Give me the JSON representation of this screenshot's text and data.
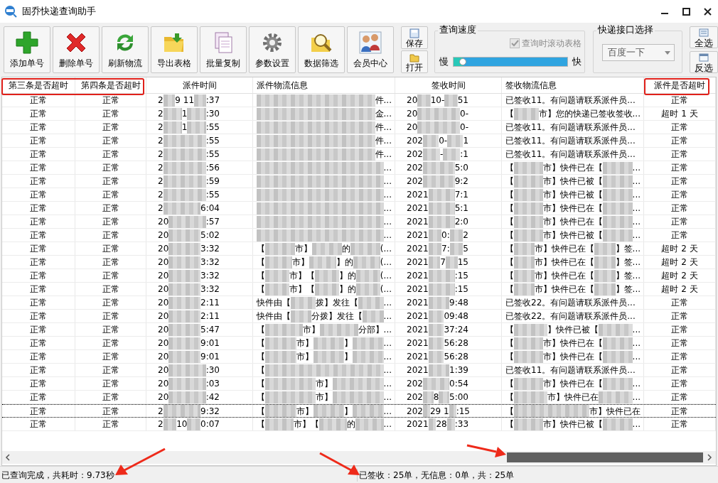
{
  "window": {
    "title": "固乔快递查询助手"
  },
  "toolbar": {
    "buttons": [
      {
        "label": "添加单号",
        "kind": "add"
      },
      {
        "label": "删除单号",
        "kind": "delete"
      },
      {
        "label": "刷新物流",
        "kind": "refresh"
      },
      {
        "label": "导出表格",
        "kind": "export"
      },
      {
        "label": "批量复制",
        "kind": "copy"
      },
      {
        "label": "参数设置",
        "kind": "settings"
      },
      {
        "label": "数据筛选",
        "kind": "filter"
      },
      {
        "label": "会员中心",
        "kind": "members"
      }
    ],
    "small_buttons": [
      {
        "label": "保存",
        "kind": "save"
      },
      {
        "label": "打开",
        "kind": "open"
      }
    ],
    "speed": {
      "title": "查询速度",
      "scroll_checkbox": {
        "label": "查询时滚动表格",
        "checked": true,
        "disabled": true
      },
      "slow": "慢",
      "fast": "快",
      "level": 0.08
    },
    "api": {
      "title": "快递接口选择",
      "dropdown": {
        "value": "百度一下"
      }
    },
    "select_buttons": [
      {
        "label": "全选",
        "kind": "select-all"
      },
      {
        "label": "反选",
        "kind": "invert"
      }
    ]
  },
  "table": {
    "columns": [
      "第三条是否超时",
      "第四条是否超时",
      "派件时间",
      "派件物流信息",
      "签收时间",
      "签收物流信息",
      "派件是否超时"
    ],
    "rows": [
      {
        "third": "正常",
        "fourth": "正常",
        "dispatch_time": [
          "2",
          "9 11",
          ":37"
        ],
        "dispatch_info": [
          "件..."
        ],
        "sign_time": [
          "20",
          "10-",
          "51"
        ],
        "sign_info": "已签收11。有问题请联系派件员...",
        "timeout_text": "正常",
        "focused": false
      },
      {
        "third": "正常",
        "fourth": "正常",
        "dispatch_time": [
          "2",
          "1",
          ":30"
        ],
        "dispatch_info": [
          "金..."
        ],
        "sign_time": [
          "20",
          "0-"
        ],
        "sign_info": [
          "【",
          "市】您的快递已签收签收..."
        ],
        "timeout_text": "超时 1 天",
        "focused": false
      },
      {
        "third": "正常",
        "fourth": "正常",
        "dispatch_time": [
          "2",
          "1",
          ":55"
        ],
        "dispatch_info": [
          "件..."
        ],
        "sign_time": [
          "20",
          "0-"
        ],
        "sign_info": "已签收11。有问题请联系派件员...",
        "timeout_text": "正常",
        "focused": false
      },
      {
        "third": "正常",
        "fourth": "正常",
        "dispatch_time": [
          "2",
          ":55"
        ],
        "dispatch_info": [
          "件..."
        ],
        "sign_time": [
          "202",
          "0-",
          "1"
        ],
        "sign_info": "已签收11。有问题请联系派件员...",
        "timeout_text": "正常",
        "focused": false
      },
      {
        "third": "正常",
        "fourth": "正常",
        "dispatch_time": [
          "2",
          ":55"
        ],
        "dispatch_info": [
          "件..."
        ],
        "sign_time": [
          "202",
          "-",
          ":1"
        ],
        "sign_info": "已签收11。有问题请联系派件员...",
        "timeout_text": "正常",
        "focused": false
      },
      {
        "third": "正常",
        "fourth": "正常",
        "dispatch_time": [
          "2",
          ":56"
        ],
        "dispatch_info": [
          "..."
        ],
        "sign_time": [
          "202",
          "5:0"
        ],
        "sign_info": [
          "【",
          "市】快件已在【",
          "..."
        ],
        "timeout_text": "正常",
        "focused": false
      },
      {
        "third": "正常",
        "fourth": "正常",
        "dispatch_time": [
          "2",
          ":59"
        ],
        "dispatch_info": [
          "..."
        ],
        "sign_time": [
          "202",
          "9:2"
        ],
        "sign_info": [
          "【",
          "市】快件已被【",
          "..."
        ],
        "timeout_text": "正常",
        "focused": false
      },
      {
        "third": "正常",
        "fourth": "正常",
        "dispatch_time": [
          "2",
          ":55"
        ],
        "dispatch_info": [
          "..."
        ],
        "sign_time": [
          "2021",
          "7:1"
        ],
        "sign_info": [
          "【",
          "市】快件已被【",
          "..."
        ],
        "timeout_text": "正常",
        "focused": false
      },
      {
        "third": "正常",
        "fourth": "正常",
        "dispatch_time": [
          "2",
          "6:04"
        ],
        "dispatch_info": [
          "..."
        ],
        "sign_time": [
          "2021",
          "5:1"
        ],
        "sign_info": [
          "【",
          "市】快件已在【",
          "..."
        ],
        "timeout_text": "正常",
        "focused": false
      },
      {
        "third": "正常",
        "fourth": "正常",
        "dispatch_time": [
          "20",
          ":57"
        ],
        "dispatch_info": [
          "..."
        ],
        "sign_time": [
          "2021",
          "2:0"
        ],
        "sign_info": [
          "【",
          "市】快件已在【",
          "..."
        ],
        "timeout_text": "正常",
        "focused": false
      },
      {
        "third": "正常",
        "fourth": "正常",
        "dispatch_time": [
          "20",
          "5:02"
        ],
        "dispatch_info": [
          "..."
        ],
        "sign_time": [
          "2021",
          "0:",
          "2"
        ],
        "sign_info": [
          "【",
          "市】快件已被【",
          "..."
        ],
        "timeout_text": "正常",
        "focused": false
      },
      {
        "third": "正常",
        "fourth": "正常",
        "dispatch_time": [
          "20",
          "3:32"
        ],
        "dispatch_info": [
          "【",
          "市】",
          "的",
          "(..."
        ],
        "sign_time": [
          "2021",
          "7:",
          "5"
        ],
        "sign_info": [
          "【",
          "市】快件已在【",
          "】签..."
        ],
        "timeout_text": "超时 2 天",
        "focused": false
      },
      {
        "third": "正常",
        "fourth": "正常",
        "dispatch_time": [
          "20",
          "3:32"
        ],
        "dispatch_info": [
          "【",
          "市】",
          "】的",
          "(..."
        ],
        "sign_time": [
          "2021",
          "7",
          "15"
        ],
        "sign_info": [
          "【",
          "市】快件已在【",
          "】签..."
        ],
        "timeout_text": "超时 2 天",
        "focused": false
      },
      {
        "third": "正常",
        "fourth": "正常",
        "dispatch_time": [
          "20",
          "3:32"
        ],
        "dispatch_info": [
          "【",
          "市】【",
          "】的",
          "(..."
        ],
        "sign_time": [
          "2021",
          ":15"
        ],
        "sign_info": [
          "【",
          "市】快件已在【",
          "】签..."
        ],
        "timeout_text": "超时 2 天",
        "focused": false
      },
      {
        "third": "正常",
        "fourth": "正常",
        "dispatch_time": [
          "20",
          "3:32"
        ],
        "dispatch_info": [
          "【",
          "市】【",
          "】的",
          "(..."
        ],
        "sign_time": [
          "2021",
          ":15"
        ],
        "sign_info": [
          "【",
          "市】快件已在【",
          "】签..."
        ],
        "timeout_text": "超时 2 天",
        "focused": false
      },
      {
        "third": "正常",
        "fourth": "正常",
        "dispatch_time": [
          "20",
          "2:11"
        ],
        "dispatch_info": [
          "快件由【",
          "拨】发往【",
          "..."
        ],
        "sign_time": [
          "2021",
          "9:48"
        ],
        "sign_info": "已签收22。有问题请联系派件员...",
        "timeout_text": "正常",
        "focused": false
      },
      {
        "third": "正常",
        "fourth": "正常",
        "dispatch_time": [
          "20",
          "2:11"
        ],
        "dispatch_info": [
          "快件由【",
          "分拨】发往【",
          "..."
        ],
        "sign_time": [
          "2021",
          "09:48"
        ],
        "sign_info": "已签收22。有问题请联系派件员...",
        "timeout_text": "正常",
        "focused": false
      },
      {
        "third": "正常",
        "fourth": "正常",
        "dispatch_time": [
          "20",
          "5:47"
        ],
        "dispatch_info": [
          "【",
          "市】",
          "分部】..."
        ],
        "sign_time": [
          "2021",
          "37:24"
        ],
        "sign_info": [
          "【",
          "】快件已被【",
          "..."
        ],
        "timeout_text": "正常",
        "focused": false
      },
      {
        "third": "正常",
        "fourth": "正常",
        "dispatch_time": [
          "20",
          "9:01"
        ],
        "dispatch_info": [
          "【",
          "市】",
          "】",
          "..."
        ],
        "sign_time": [
          "2021",
          "56:28"
        ],
        "sign_info": [
          "【",
          "市】快件已在【",
          "..."
        ],
        "timeout_text": "正常",
        "focused": false
      },
      {
        "third": "正常",
        "fourth": "正常",
        "dispatch_time": [
          "20",
          "9:01"
        ],
        "dispatch_info": [
          "【",
          "市】",
          "】",
          "..."
        ],
        "sign_time": [
          "2021",
          "56:28"
        ],
        "sign_info": [
          "【",
          "市】快件已在【",
          "..."
        ],
        "timeout_text": "正常",
        "focused": false
      },
      {
        "third": "正常",
        "fourth": "正常",
        "dispatch_time": [
          "20",
          ":30"
        ],
        "dispatch_info": [
          "【",
          "..."
        ],
        "sign_time": [
          "2021",
          "1:39"
        ],
        "sign_info": "已签收11。有问题请联系派件员...",
        "timeout_text": "正常",
        "focused": false
      },
      {
        "third": "正常",
        "fourth": "正常",
        "dispatch_time": [
          "20",
          ":03"
        ],
        "dispatch_info": [
          "【",
          "市】",
          "..."
        ],
        "sign_time": [
          "202",
          "0:54"
        ],
        "sign_info": [
          "【",
          "市】快件已在【",
          "..."
        ],
        "timeout_text": "正常",
        "focused": false
      },
      {
        "third": "正常",
        "fourth": "正常",
        "dispatch_time": [
          "20",
          ":42"
        ],
        "dispatch_info": [
          "【",
          "市】",
          "..."
        ],
        "sign_time": [
          "202",
          "8",
          "5:00"
        ],
        "sign_info": [
          "【",
          "市】快件已在",
          "..."
        ],
        "timeout_text": "正常",
        "focused": false
      },
      {
        "third": "正常",
        "fourth": "正常",
        "dispatch_time": [
          "2",
          "9:32"
        ],
        "dispatch_info": [
          "【",
          "市】",
          "】",
          "..."
        ],
        "sign_time": [
          "202",
          "29 1",
          ":15"
        ],
        "sign_info": [
          "【",
          "市】快件已在"
        ],
        "timeout_text": "正常",
        "focused": true
      },
      {
        "third": "正常",
        "fourth": "正常",
        "dispatch_time": [
          "2",
          "10",
          "0:07"
        ],
        "dispatch_info": [
          "【",
          "市】【",
          "的",
          "..."
        ],
        "sign_time": [
          "2021",
          "28",
          ":33"
        ],
        "sign_info": [
          "【",
          "市】快件已被【",
          "..."
        ],
        "timeout_text": "正常",
        "focused": false
      }
    ]
  },
  "status_bar": {
    "left": "已查询完成，共耗时：9.73秒",
    "right": "已签收：25单，无信息：0单，共：25单"
  }
}
